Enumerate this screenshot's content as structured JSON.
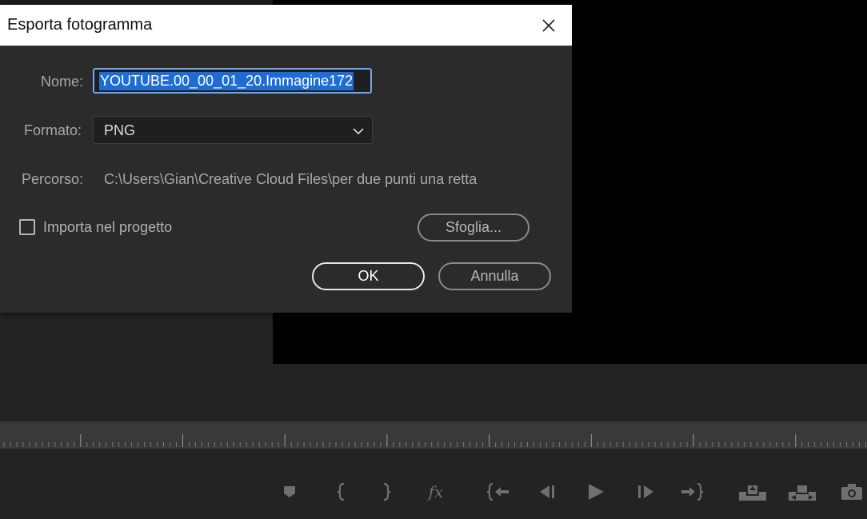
{
  "dialog": {
    "title": "Esporta fotogramma",
    "close_icon": "close-icon",
    "name_label": "Nome:",
    "name_value": "YOUTUBE.00_00_01_20.Immagine172",
    "format_label": "Formato:",
    "format_value": "PNG",
    "path_label": "Percorso:",
    "path_value": "C:\\Users\\Gian\\Creative Cloud Files\\per due punti una retta",
    "import_label": "Importa nel progetto",
    "import_checked": false,
    "browse_label": "Sfoglia...",
    "ok_label": "OK",
    "cancel_label": "Annulla"
  },
  "transport": {
    "icons": [
      "marker-icon",
      "mark-in-icon",
      "mark-out-icon",
      "fx-icon",
      "go-to-in-icon",
      "step-back-icon",
      "play-icon",
      "step-forward-icon",
      "go-to-out-icon",
      "lift-icon",
      "extract-icon",
      "export-frame-icon"
    ],
    "fx_text": "fx"
  },
  "colors": {
    "panel_bg": "#232323",
    "dialog_bg": "#2b2b2b",
    "title_bar": "#ffffff",
    "selection": "#1f6dd4",
    "focus_border": "#6fa6ee",
    "ruler_bg": "#393939"
  }
}
